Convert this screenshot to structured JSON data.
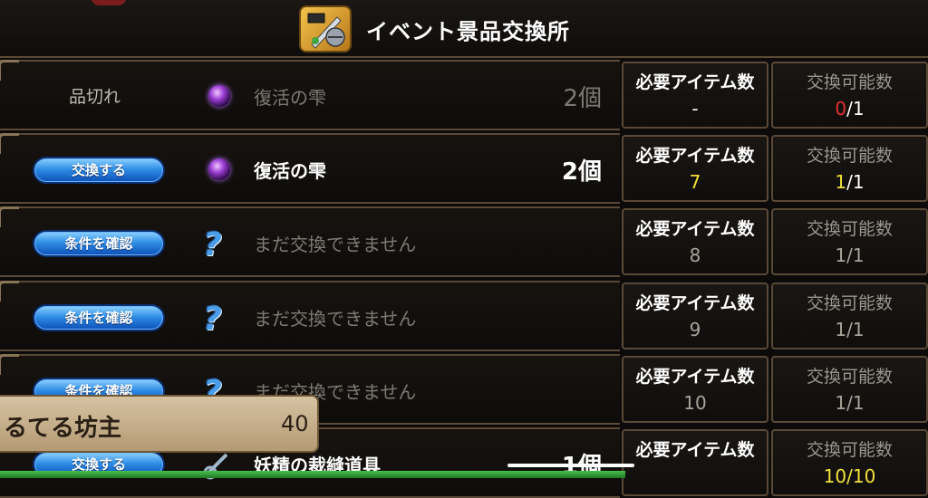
{
  "header": {
    "title": "イベント景品交換所",
    "icon": "sword-helmet-icon"
  },
  "labels": {
    "required": "必要アイテム数",
    "available": "交換可能数"
  },
  "rows": [
    {
      "action": "品切れ",
      "item": "復活の雫",
      "qty": "2個",
      "required": "-",
      "available_used": "0",
      "available_total": "/1"
    },
    {
      "action": "交換する",
      "item": "復活の雫",
      "qty": "2個",
      "required": "7",
      "available_used": "1",
      "available_total": "/1"
    },
    {
      "action": "条件を確認",
      "item": "まだ交換できません",
      "required": "8",
      "available": "1/1"
    },
    {
      "action": "条件を確認",
      "item": "まだ交換できません",
      "required": "9",
      "available": "1/1"
    },
    {
      "action": "条件を確認",
      "item": "まだ交換できません",
      "required": "10",
      "available": "1/1"
    },
    {
      "action": "交換する",
      "item": "妖精の裁縫道具",
      "qty": "1個",
      "required": "",
      "available": "10/10"
    }
  ],
  "overlay": {
    "name": "るてる坊主",
    "count": "40"
  },
  "colors": {
    "accent_button": "#2f8fe6",
    "frame": "#5a4936",
    "highlight_yellow": "#f2e23a",
    "highlight_red": "#e53030"
  }
}
